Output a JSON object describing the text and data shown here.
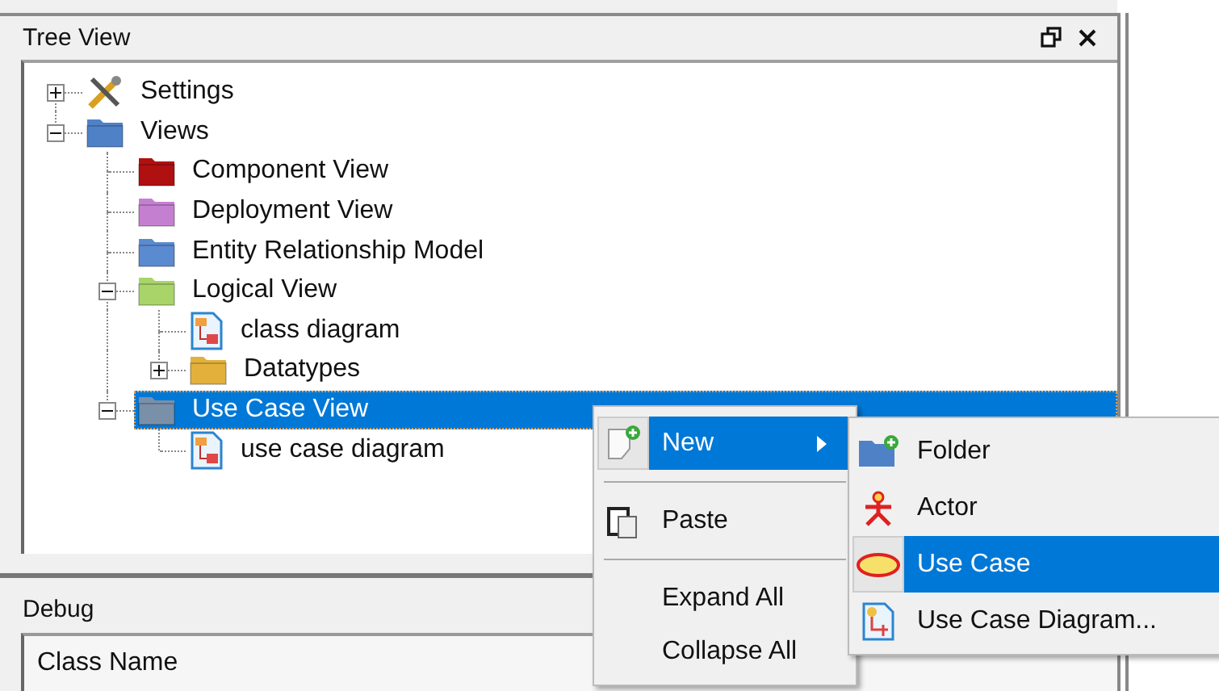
{
  "tree_view": {
    "title": "Tree View",
    "items": [
      {
        "label": "Settings",
        "kind": "tools",
        "expanded": false,
        "selected": false
      },
      {
        "label": "Views",
        "kind": "folder",
        "color": "#4f81c7",
        "expanded": true,
        "selected": false,
        "children": [
          {
            "label": "Component View",
            "kind": "folder",
            "color": "#b01010",
            "selected": false
          },
          {
            "label": "Deployment View",
            "kind": "folder",
            "color": "#c57fd0",
            "selected": false
          },
          {
            "label": "Entity Relationship Model",
            "kind": "folder",
            "color": "#5a8ad0",
            "selected": false
          },
          {
            "label": "Logical View",
            "kind": "folder",
            "color": "#a8d46a",
            "expanded": true,
            "selected": false,
            "children": [
              {
                "label": "class diagram",
                "kind": "diagram",
                "selected": false
              },
              {
                "label": "Datatypes",
                "kind": "folder",
                "color": "#e2b13c",
                "expanded": false,
                "selected": false
              }
            ]
          },
          {
            "label": "Use Case View",
            "kind": "folder",
            "color": "#7a8fa8",
            "expanded": true,
            "selected": true,
            "children": [
              {
                "label": "use case diagram",
                "kind": "diagram",
                "selected": false
              }
            ]
          }
        ]
      }
    ]
  },
  "debug": {
    "title": "Debug",
    "column_1": "Class Name"
  },
  "context_menu": [
    {
      "kind": "item",
      "label": "New",
      "selected": true,
      "submenu": [
        {
          "label": "Folder",
          "selected": false
        },
        {
          "label": "Actor",
          "selected": false
        },
        {
          "label": "Use Case",
          "selected": true
        },
        {
          "label": "Use Case Diagram...",
          "selected": false
        }
      ]
    },
    {
      "kind": "separator"
    },
    {
      "kind": "item",
      "label": "Paste",
      "selected": false
    },
    {
      "kind": "separator"
    },
    {
      "kind": "item",
      "label": "Expand All",
      "selected": false
    },
    {
      "kind": "item",
      "label": "Collapse All",
      "selected": false
    }
  ]
}
